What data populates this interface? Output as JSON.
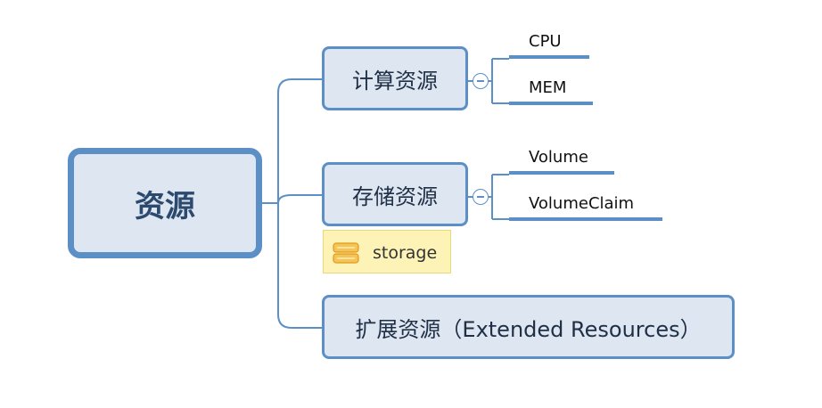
{
  "mindmap": {
    "root": {
      "label": "资源"
    },
    "branches": [
      {
        "label": "计算资源",
        "children": [
          "CPU",
          "MEM"
        ],
        "collapse_icon": "collapse-minus-icon"
      },
      {
        "label": "存储资源",
        "children": [
          "Volume",
          "VolumeClaim"
        ],
        "collapse_icon": "collapse-minus-icon",
        "label_tag": {
          "text": "storage",
          "icon": "storage-icon"
        }
      },
      {
        "label": "扩展资源（Extended Resources）",
        "children": []
      }
    ]
  },
  "colors": {
    "topic_fill": "#dde6f1",
    "topic_border": "#5d8fc7",
    "root_text": "#2b4a6e",
    "topic_text": "#1f2f45",
    "leaf_underline": "#5d8fc7",
    "label_fill": "#fdf3b7",
    "label_border": "#e8d97a",
    "storage_icon": "#f3b13a"
  }
}
